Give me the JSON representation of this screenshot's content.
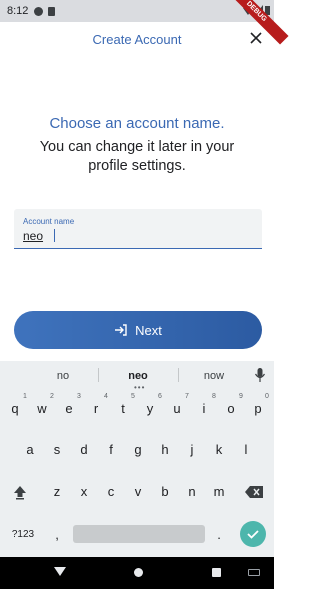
{
  "status_bar": {
    "time": "8:12",
    "debug_label": "DEBUG"
  },
  "header": {
    "title": "Create Account",
    "close_glyph": "✕"
  },
  "content": {
    "heading": "Choose an account name.",
    "subtext": "You can change it later in your profile settings."
  },
  "form": {
    "field_label": "Account name",
    "field_value": "neo"
  },
  "actions": {
    "next_label": "Next"
  },
  "keyboard": {
    "suggestions": [
      "no",
      "neo",
      "now"
    ],
    "row1": [
      "q",
      "w",
      "e",
      "r",
      "t",
      "y",
      "u",
      "i",
      "o",
      "p"
    ],
    "row1_hints": [
      "1",
      "2",
      "3",
      "4",
      "5",
      "6",
      "7",
      "8",
      "9",
      "0"
    ],
    "row2": [
      "a",
      "s",
      "d",
      "f",
      "g",
      "h",
      "j",
      "k",
      "l"
    ],
    "row3": [
      "z",
      "x",
      "c",
      "v",
      "b",
      "n",
      "m"
    ],
    "symbols_label": "?123",
    "comma": ",",
    "period": "."
  },
  "colors": {
    "accent": "#3b69b3",
    "enter_key": "#4db6ac",
    "keyboard_bg": "#eceff1"
  }
}
